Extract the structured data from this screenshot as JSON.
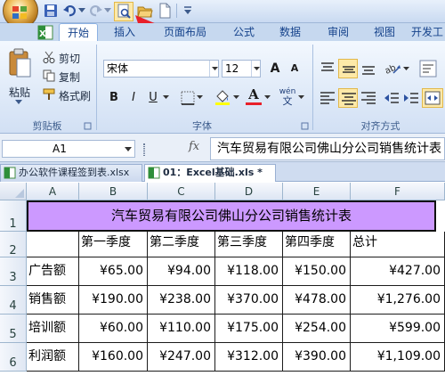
{
  "quick_access": {
    "icons": [
      "save-icon",
      "undo-icon",
      "redo-icon",
      "print-preview-icon",
      "open-icon",
      "new-icon",
      "customize-icon"
    ]
  },
  "tabs": [
    "开始",
    "插入",
    "页面布局",
    "公式",
    "数据",
    "审阅",
    "视图",
    "开发工"
  ],
  "ribbon": {
    "clipboard": {
      "paste": "粘贴",
      "cut": "剪切",
      "copy": "复制",
      "format_painter": "格式刷",
      "label": "剪贴板"
    },
    "font": {
      "name": "宋体",
      "size": "12",
      "grow": "A",
      "shrink": "A",
      "bold": "B",
      "italic": "I",
      "underline": "U",
      "phonetic": "wén",
      "font_color_letter": "A",
      "label": "字体"
    },
    "alignment": {
      "label": "对齐方式"
    }
  },
  "formula_bar": {
    "name_box": "A1",
    "fx": "fx",
    "content": "汽车贸易有限公司佛山分公司销售统计表"
  },
  "workbooks": [
    {
      "label": "办公软件课程签到表.xlsx",
      "active": false
    },
    {
      "label": "01：Excel基础.xls *",
      "active": true
    }
  ],
  "colors": {
    "title_fill": "#cc99ff",
    "accent": "#15428b",
    "arrow": "#e8202a"
  },
  "sheet": {
    "columns": [
      "A",
      "B",
      "C",
      "D",
      "E",
      "F"
    ],
    "rows": [
      "1",
      "2",
      "3",
      "4",
      "5",
      "6"
    ],
    "title": "汽车贸易有限公司佛山分公司销售统计表",
    "headers": [
      "",
      "第一季度",
      "第二季度",
      "第三季度",
      "第四季度",
      "总计"
    ],
    "data": [
      [
        "广告额",
        "¥65.00",
        "¥94.00",
        "¥118.00",
        "¥150.00",
        "¥427.00"
      ],
      [
        "销售额",
        "¥190.00",
        "¥238.00",
        "¥370.00",
        "¥478.00",
        "¥1,276.00"
      ],
      [
        "培训额",
        "¥60.00",
        "¥110.00",
        "¥175.00",
        "¥254.00",
        "¥599.00"
      ],
      [
        "利润额",
        "¥160.00",
        "¥247.00",
        "¥312.00",
        "¥390.00",
        "¥1,109.00"
      ]
    ]
  }
}
